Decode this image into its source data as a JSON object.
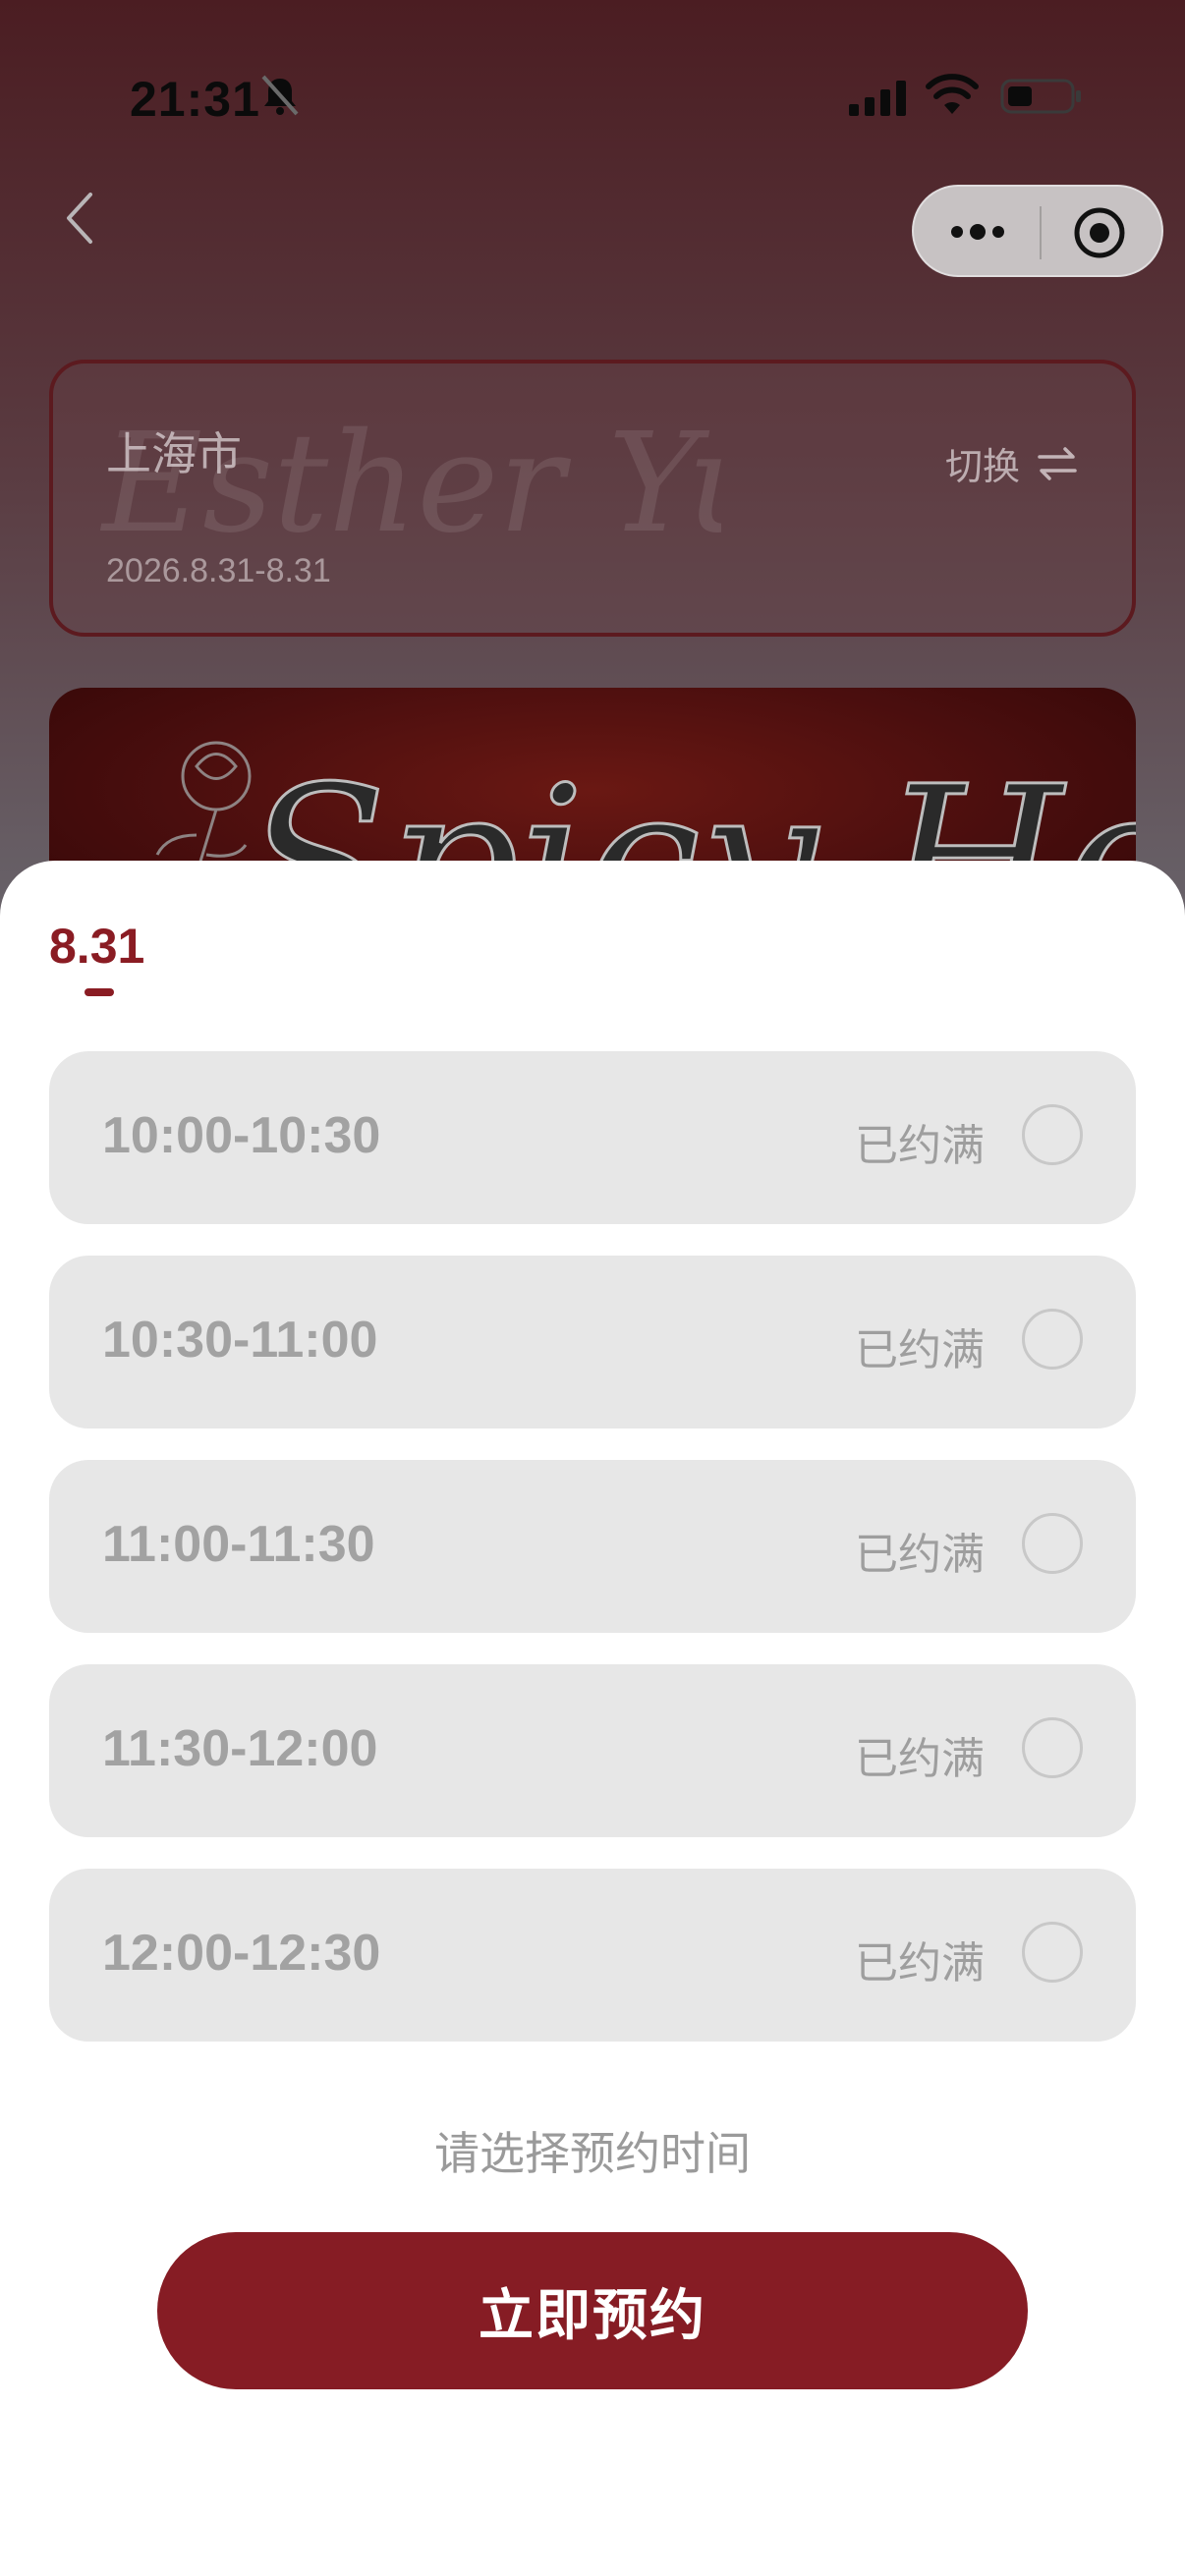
{
  "status_bar": {
    "time": "21:31",
    "icons": [
      "bell-muted-icon",
      "signal-icon",
      "wifi-icon",
      "battery-icon"
    ]
  },
  "nav": {
    "back_icon": "chevron-left-icon",
    "capsule_icons": [
      "more-dots-icon",
      "target-icon"
    ]
  },
  "city_card": {
    "city": "上海市",
    "dates": "2026.8.31-8.31",
    "switch_label": "切换",
    "switch_icon": "swap-icon",
    "watermark_text": "Esther Yu"
  },
  "banner": {
    "art_text": "Spicy Honey"
  },
  "sheet": {
    "date_tab": "8.31",
    "slots": [
      {
        "time": "10:00-10:30",
        "status": "已约满"
      },
      {
        "time": "10:30-11:00",
        "status": "已约满"
      },
      {
        "time": "11:00-11:30",
        "status": "已约满"
      },
      {
        "time": "11:30-12:00",
        "status": "已约满"
      },
      {
        "time": "12:00-12:30",
        "status": "已约满"
      }
    ],
    "hint": "请选择预约时间",
    "book_label": "立即预约"
  },
  "colors": {
    "accent": "#861c24",
    "slot_bg": "#e7e7e7"
  }
}
